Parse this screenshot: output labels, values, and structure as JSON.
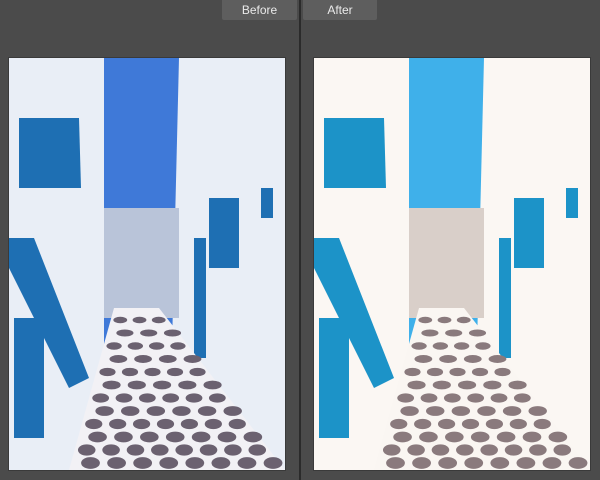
{
  "compare": {
    "before_label": "Before",
    "after_label": "After"
  },
  "photos": {
    "before": {
      "sky": "#3f79d8",
      "wall": "#e9eef6",
      "shadow": "#b9c4d9",
      "trim": "#1e6fb3",
      "path_stone": "#6b6170",
      "path_grout": "#f2f1f5"
    },
    "after": {
      "sky": "#3fb0ea",
      "wall": "#fbf7f3",
      "shadow": "#d9cfc9",
      "trim": "#1c93c8",
      "path_stone": "#8a7a7d",
      "path_grout": "#faf6f2"
    }
  }
}
